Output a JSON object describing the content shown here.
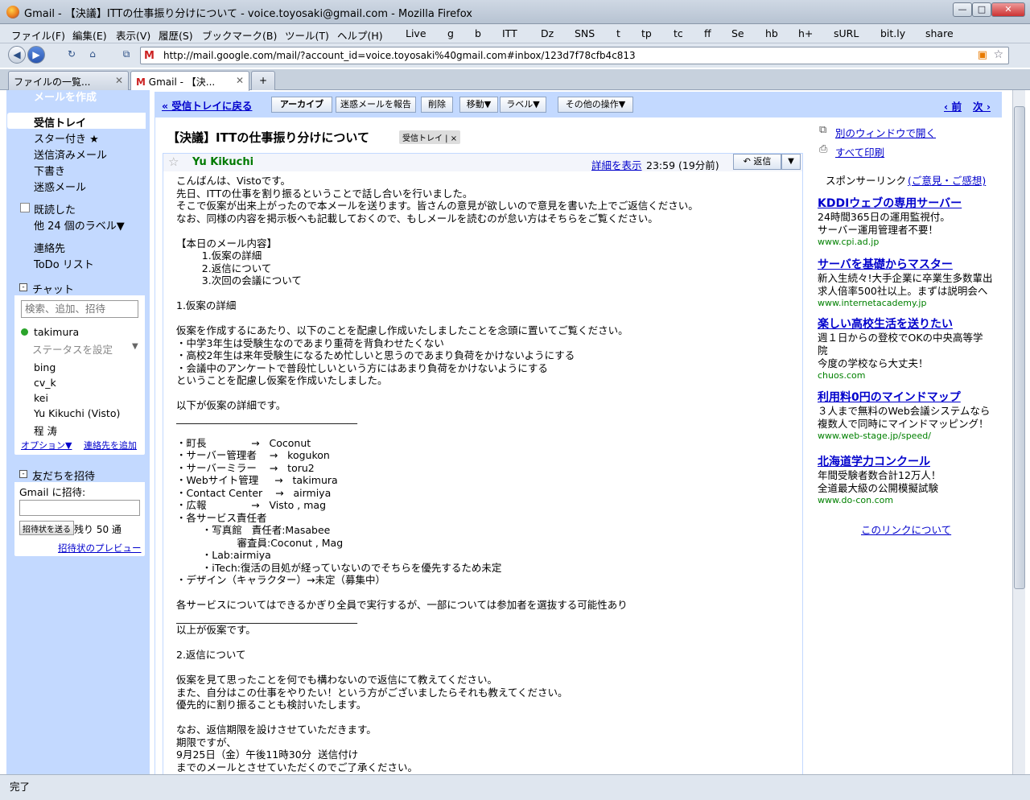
{
  "window": {
    "title": "Gmail - 【決議】ITTの仕事振り分けについて - voice.toyosaki@gmail.com - Mozilla Firefox"
  },
  "menu": [
    "ファイル(F)",
    "編集(E)",
    "表示(V)",
    "履歴(S)",
    "ブックマーク(B)",
    "ツール(T)",
    "ヘルプ(H)"
  ],
  "bookmarks": [
    "Live",
    "g",
    "b",
    "ITT",
    "Dz",
    "SNS",
    "t",
    "tp",
    "tc",
    "ff",
    "Se",
    "hb",
    "h+",
    "sURL",
    "bit.ly",
    "share"
  ],
  "url": "http://mail.google.com/mail/?account_id=voice.toyosaki%40gmail.com#inbox/123d7f78cfb4c813",
  "tabs": [
    "ファイルの一覧...",
    "Gmail - 【決..."
  ],
  "sidebar": {
    "compose": "メールを作成",
    "nav": [
      "受信トレイ",
      "スター付き ★",
      "送信済みメール",
      "下書き",
      "迷惑メール"
    ],
    "labels": [
      "既読した",
      "他 24 個のラベル▼",
      "連絡先",
      "ToDo リスト"
    ]
  },
  "chat": {
    "title": "チャット",
    "search_placeholder": "検索、追加、招待",
    "me": "takimura",
    "status": "ステータスを設定",
    "contacts": [
      "bing",
      "cv_k",
      "kei",
      "Yu Kikuchi (Visto)",
      "程 涛"
    ],
    "options": "オプション▼",
    "add_contact": "連絡先を追加"
  },
  "invite": {
    "title": "友だちを招待",
    "label": "Gmail に招待:",
    "button": "招待状を送る",
    "remaining": "残り 50 通",
    "preview": "招待状のプレビュー"
  },
  "toolbar": {
    "back": "« 受信トレイに戻る",
    "archive": "アーカイブ",
    "spam": "迷惑メールを報告",
    "delete": "削除",
    "move": "移動▼",
    "label": "ラベル▼",
    "more": "その他の操作▼",
    "prev": "‹ 前",
    "next": "次 ›"
  },
  "message": {
    "subject": "【決議】ITTの仕事振り分けについて",
    "inbox_tag": "受信トレイ | ×",
    "sender": "Yu Kikuchi",
    "show_details": "詳細を表示",
    "time": "23:59 (19分前)",
    "reply": "返信",
    "body": "こんばんは、Vistoです。\n先日、ITTの仕事を割り振るということで話し合いを行いました。\nそこで仮案が出来上がったので本メールを送ります。皆さんの意見が欲しいので意見を書いた上でご返信ください。\nなお、同様の内容を掲示板へも記載しておくので、もしメールを読むのが怠い方はそちらをご覧ください。\n\n【本日のメール内容】\n        1.仮案の詳細\n        2.返信について\n        3.次回の会議について\n\n1.仮案の詳細\n\n仮案を作成するにあたり、以下のことを配慮し作成いたしましたことを念頭に置いてご覧ください。\n・中学3年生は受験生なのであまり重荷を背負わせたくない\n・高校2年生は来年受験生になるため忙しいと思うのであまり負荷をかけないようにする\n・会議中のアンケートで普段忙しいという方にはあまり負荷をかけないようにする\nということを配慮し仮案を作成いたしました。\n\n以下が仮案の詳細です。\n____________________________________\n\n・町長              →   Coconut\n・サーバー管理者    →   kogukon\n・サーバーミラー    →   toru2\n・Webサイト管理     →   takimura\n・Contact Center    →   airmiya\n・広報              →   Visto , mag\n・各サービス責任者\n        ・写真館   責任者:Masabee\n                   審査員:Coconut , Mag\n        ・Lab:airmiya\n        ・iTech:復活の目処が経っていないのでそちらを優先するため未定\n・デザイン（キャラクター）→未定（募集中）\n\n各サービスについてはできるかぎり全員で実行するが、一部については参加者を選抜する可能性あり\n____________________________________\n以上が仮案です。\n\n2.返信について\n\n仮案を見て思ったことを何でも構わないので返信にて教えてください。\nまた、自分はこの仕事をやりたい！という方がございましたらそれも教えてください。\n優先的に割り振ることも検討いたします。\n\nなお、返信期限を設けさせていただきます。\n期限ですが、\n9月25日（金）午後11時30分  送信付け\nまでのメールとさせていただくのでご了承ください。"
  },
  "right": {
    "newwin": "別のウィンドウで開く",
    "print": "すべて印刷",
    "sponsor": "スポンサーリンク",
    "feedback": "(ご意見・ご感想)",
    "ads": [
      {
        "title": "KDDIウェブの専用サーバー",
        "desc": "24時間365日の運用監視付。\nサーバー運用管理者不要！",
        "url": "www.cpi.ad.jp"
      },
      {
        "title": "サーバを基礎からマスター",
        "desc": "新入生続々!大手企業に卒業生多数輩出\n求人倍率500社以上。まずは説明会へ",
        "url": "www.internetacademy.jp"
      },
      {
        "title": "楽しい高校生活を送りたい",
        "desc": "週１日からの登校でOKの中央高等学\n院\n今度の学校なら大丈夫！",
        "url": "chuos.com"
      },
      {
        "title": "利用料0円のマインドマップ",
        "desc": "３人まで無料のWeb会議システムなら\n複数人で同時にマインドマッピング！",
        "url": "www.web-stage.jp/speed/"
      },
      {
        "title": "北海道学力コンクール",
        "desc": "年間受験者数合計12万人！\n全道最大級の公開模擬試験",
        "url": "www.do-con.com"
      }
    ],
    "about": "このリンクについて"
  },
  "status": "完了"
}
